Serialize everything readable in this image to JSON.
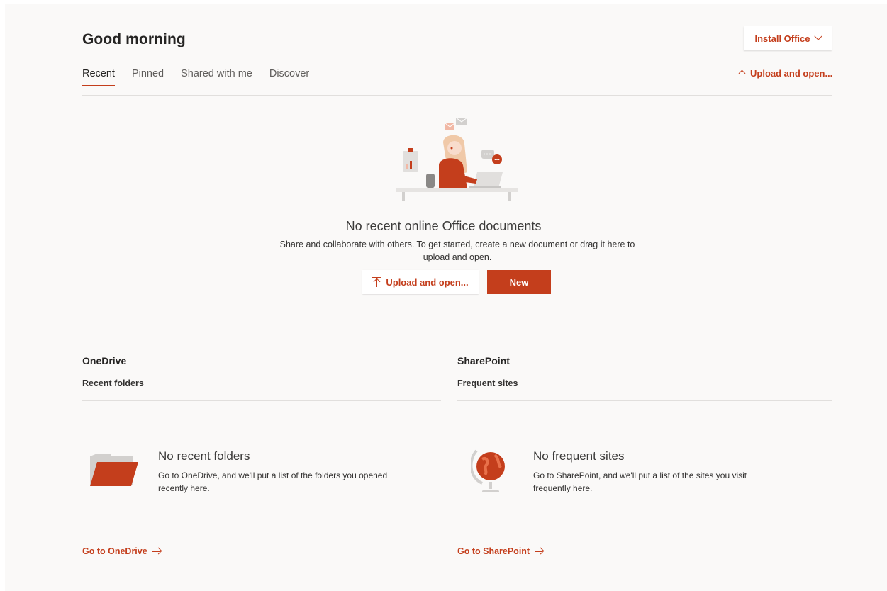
{
  "header": {
    "greeting": "Good morning",
    "install_label": "Install Office",
    "upload_label": "Upload and open..."
  },
  "tabs": [
    {
      "label": "Recent",
      "active": true
    },
    {
      "label": "Pinned",
      "active": false
    },
    {
      "label": "Shared with me",
      "active": false
    },
    {
      "label": "Discover",
      "active": false
    }
  ],
  "empty_state": {
    "title": "No recent online Office documents",
    "description": "Share and collaborate with others. To get started, create a new document or drag it here to upload and open.",
    "upload_label": "Upload and open...",
    "new_label": "New"
  },
  "onedrive": {
    "title": "OneDrive",
    "subtitle": "Recent folders",
    "empty_title": "No recent folders",
    "empty_text": "Go to OneDrive, and we'll put a list of the folders you opened recently here.",
    "link_label": "Go to OneDrive"
  },
  "sharepoint": {
    "title": "SharePoint",
    "subtitle": "Frequent sites",
    "empty_title": "No frequent sites",
    "empty_text": "Go to SharePoint, and we'll put a list of the sites you visit frequently here.",
    "link_label": "Go to SharePoint"
  },
  "colors": {
    "accent": "#c43e1c",
    "background": "#faf9f8",
    "divider": "#e1dfdd"
  },
  "icons": [
    "chevron-down-icon",
    "upload-icon",
    "arrow-right-icon",
    "folder-icon",
    "globe-icon"
  ]
}
